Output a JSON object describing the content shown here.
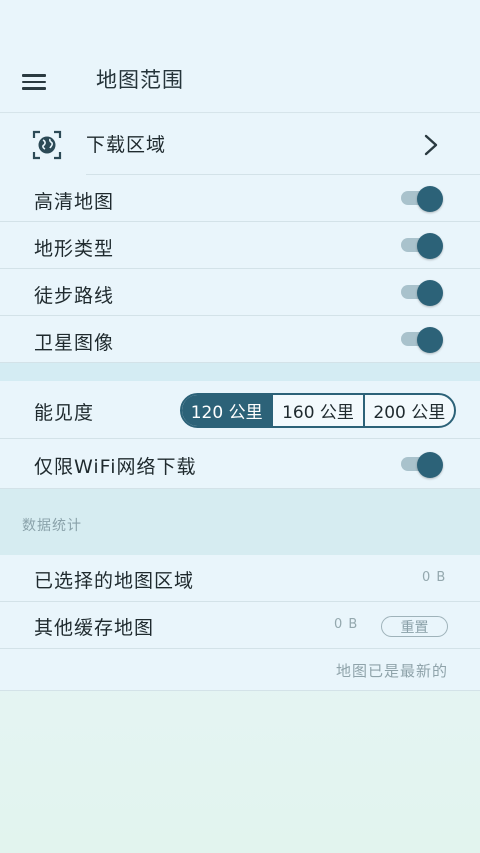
{
  "header": {
    "title": "地图范围",
    "menu_icon": "menu-icon"
  },
  "download": {
    "label": "下载区域",
    "icon": "globe-icon"
  },
  "toggles": [
    {
      "label": "高清地图",
      "on": true
    },
    {
      "label": "地形类型",
      "on": true
    },
    {
      "label": "徒步路线",
      "on": true
    },
    {
      "label": "卫星图像",
      "on": true
    }
  ],
  "visibility": {
    "label": "能见度",
    "options": [
      "120 公里",
      "160 公里",
      "200 公里"
    ],
    "selected": "120 公里"
  },
  "wifi": {
    "label": "仅限WiFi网络下载",
    "on": true
  },
  "stats": {
    "section_title": "数据统计",
    "selected_area_label": "已选择的地图区域",
    "selected_area_size": "0 B",
    "other_cache_label": "其他缓存地图",
    "other_cache_size": "0 B",
    "reset_label": "重置",
    "status": "地图已是最新的"
  },
  "colors": {
    "accent": "#2c6278",
    "background": "#e9f5fb"
  }
}
